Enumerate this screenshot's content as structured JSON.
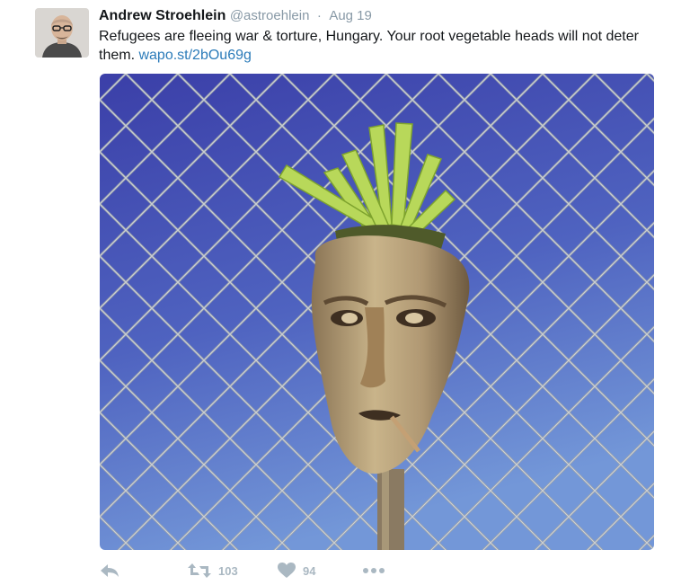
{
  "tweet": {
    "author_name": "Andrew Stroehlein",
    "handle": "@astroehlein",
    "separator": "·",
    "date": "Aug 19",
    "text": "Refugees are fleeing war & torture, Hungary. Your root vegetable heads will not deter them. ",
    "link_text": "wapo.st/2bOu69g",
    "media_subject": "root vegetable carved into a face hanging on a chain-link fence against blue sky",
    "retweet_count": "103",
    "like_count": "94"
  },
  "icons": {
    "reply": "reply-icon",
    "retweet": "retweet-icon",
    "like": "heart-icon",
    "more": "more-icon"
  },
  "colors": {
    "sky_top": "#3b3fa8",
    "sky_bottom": "#6f8fd6",
    "link": "#2b7bb9",
    "muted": "#8899a6",
    "action_gray": "#aab8c2"
  }
}
